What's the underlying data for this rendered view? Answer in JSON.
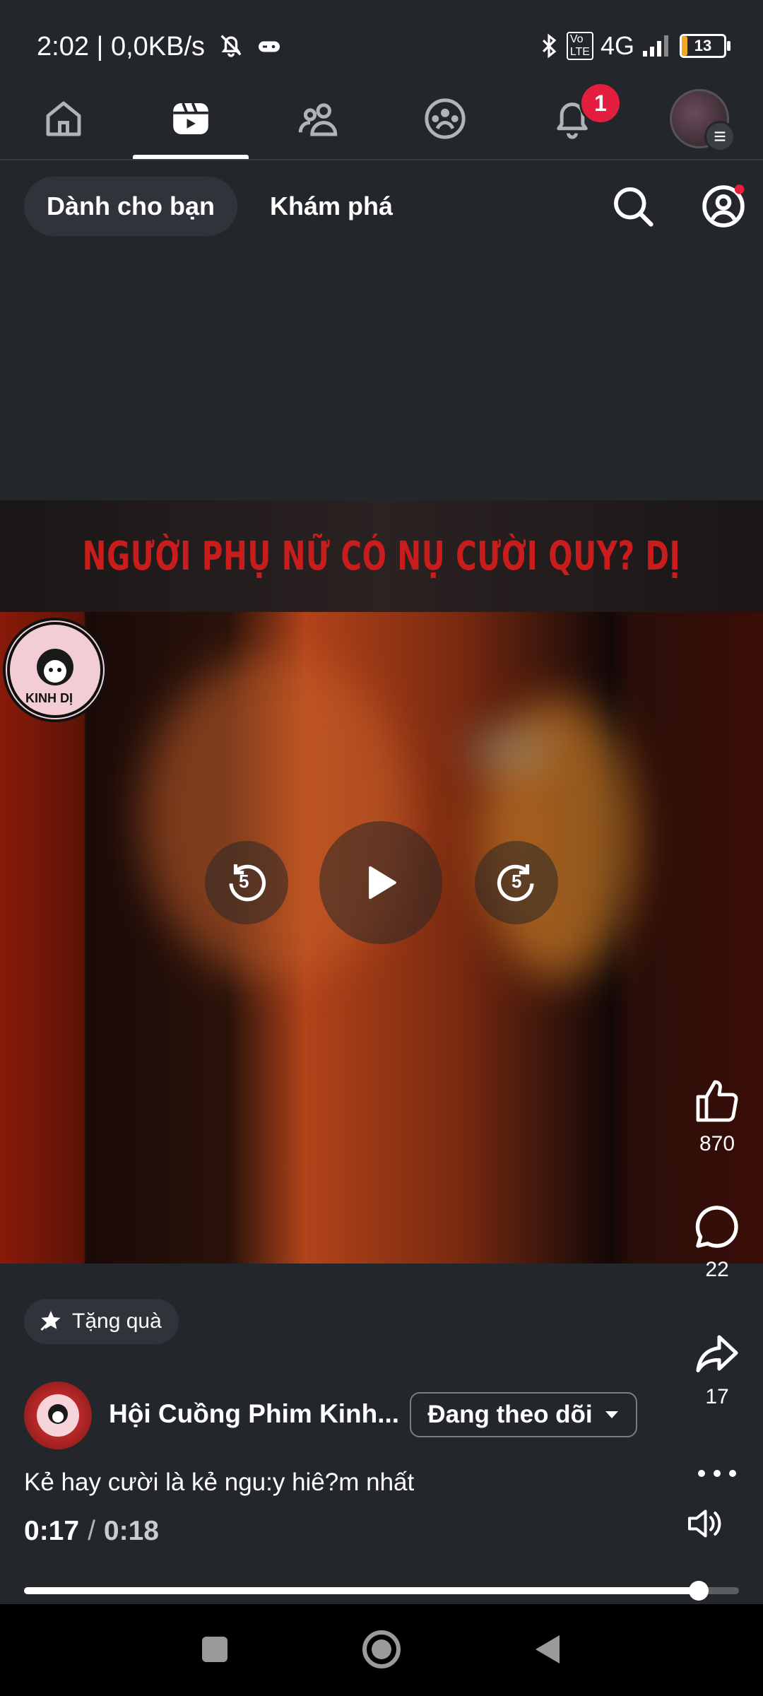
{
  "status_bar": {
    "time_text": "2:02 | 0,0KB/s",
    "network": "4G",
    "battery": "13",
    "battery_level_pct": 13
  },
  "top_nav": {
    "notification_badge": "1",
    "active_tab": "video"
  },
  "feed_tabs": {
    "for_you": "Dành cho bạn",
    "explore": "Khám phá"
  },
  "video": {
    "banner_text": "NGƯỜI PHỤ NỮ CÓ NỤ CƯỜI QUY? DỊ",
    "skip_back": "5",
    "skip_forward": "5",
    "watermark_text": "KINH DỊ"
  },
  "actions": {
    "likes": "870",
    "comments": "22",
    "shares": "17"
  },
  "gift_label": "Tặng quà",
  "author": {
    "name": "Hội Cuồng Phim Kinh...",
    "follow_label": "Đang theo dõi"
  },
  "caption": "Kẻ hay cười là kẻ ngu:y hiê?m nhất",
  "playback": {
    "current": "0:17",
    "separator": "/",
    "total": "0:18",
    "progress_fraction": 0.944
  },
  "colors": {
    "background": "#23262b",
    "badge": "#e41e3f",
    "banner_text": "#c91d1d"
  }
}
